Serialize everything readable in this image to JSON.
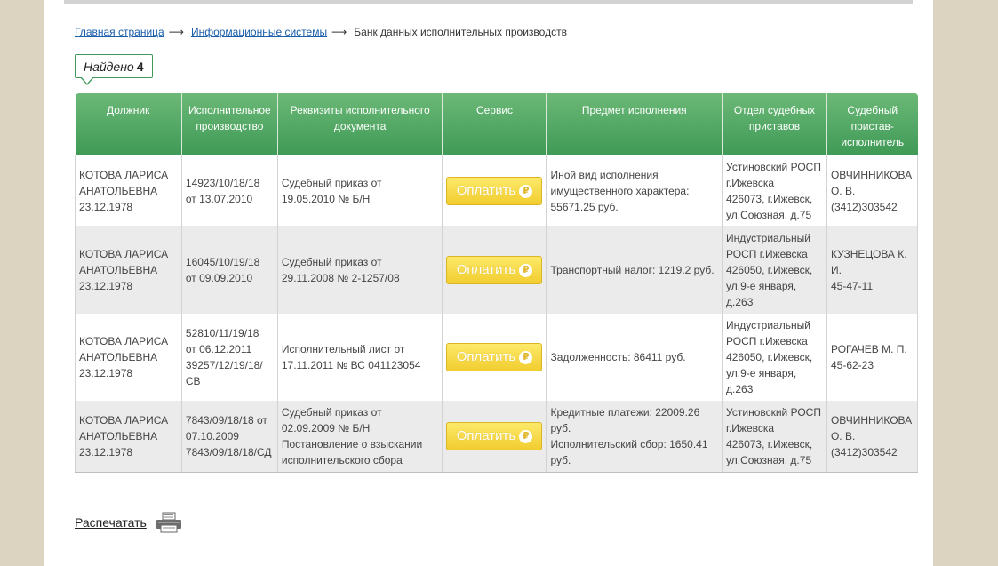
{
  "breadcrumb": {
    "home": "Главная страница",
    "systems": "Информационные системы",
    "current": "Банк данных исполнительных производств",
    "separator": "⟶"
  },
  "found": {
    "label": "Найдено",
    "count": "4"
  },
  "table": {
    "headers": [
      "Должник",
      "Исполнительное производство",
      "Реквизиты исполнительного документа",
      "Сервис",
      "Предмет исполнения",
      "Отдел судебных приставов",
      "Судебный пристав-исполнитель"
    ],
    "pay_label": "Оплатить",
    "rub_symbol": "₽",
    "rows": [
      {
        "debtor": [
          "КОТОВА ЛАРИСА",
          "АНАТОЛЬЕВНА",
          "23.12.1978"
        ],
        "proceeding": [
          "14923/10/18/18",
          "от 13.07.2010"
        ],
        "document": [
          "Судебный приказ от",
          "19.05.2010 № Б/Н"
        ],
        "subject": [
          "Иной вид исполнения",
          "имущественного характера:",
          "55671.25 руб."
        ],
        "department": [
          "Устиновский РОСП",
          "г.Ижевска",
          "426073, г.Ижевск,",
          "ул.Союзная, д.75"
        ],
        "bailiff": [
          "ОВЧИННИКОВА",
          "О. В.",
          "(3412)303542"
        ]
      },
      {
        "debtor": [
          "КОТОВА ЛАРИСА",
          "АНАТОЛЬЕВНА",
          "23.12.1978"
        ],
        "proceeding": [
          "16045/10/19/18",
          "от 09.09.2010"
        ],
        "document": [
          "Судебный приказ от",
          "29.11.2008 № 2-1257/08"
        ],
        "subject": [
          "Транспортный налог: 1219.2 руб."
        ],
        "department": [
          "Индустриальный",
          "РОСП г.Ижевска",
          "426050, г.Ижевск,",
          "ул.9-е января,",
          "д.263"
        ],
        "bailiff": [
          "КУЗНЕЦОВА К.",
          "И.",
          "45-47-11"
        ]
      },
      {
        "debtor": [
          "КОТОВА ЛАРИСА",
          "АНАТОЛЬЕВНА",
          "23.12.1978"
        ],
        "proceeding": [
          "52810/11/19/18",
          "от 06.12.2011",
          "39257/12/19/18/",
          "СВ"
        ],
        "document": [
          "Исполнительный лист от",
          "17.11.2011 № ВС 041123054"
        ],
        "subject": [
          "Задолженность: 86411 руб."
        ],
        "department": [
          "Индустриальный",
          "РОСП г.Ижевска",
          "426050, г.Ижевск,",
          "ул.9-е января,",
          "д.263"
        ],
        "bailiff": [
          "РОГАЧЕВ М. П.",
          "45-62-23"
        ]
      },
      {
        "debtor": [
          "КОТОВА ЛАРИСА",
          "АНАТОЛЬЕВНА",
          "23.12.1978"
        ],
        "proceeding": [
          "7843/09/18/18 от",
          "07.10.2009",
          "7843/09/18/18/СД"
        ],
        "document": [
          "Судебный приказ от",
          "02.09.2009 № Б/Н",
          "Постановление о взыскании",
          "исполнительского сбора"
        ],
        "subject": [
          "Кредитные платежи: 22009.26",
          "руб.",
          "Исполнительский сбор: 1650.41",
          "руб."
        ],
        "department": [
          "Устиновский РОСП",
          "г.Ижевска",
          "426073, г.Ижевск,",
          "ул.Союзная, д.75"
        ],
        "bailiff": [
          "ОВЧИННИКОВА",
          "О. В.",
          "(3412)303542"
        ]
      }
    ]
  },
  "print": {
    "label": "Распечатать",
    "icon": "printer-icon"
  },
  "colors": {
    "header_green": "#4ca762",
    "link_blue": "#1a5eab",
    "button_yellow": "#f6d83f",
    "row_alt": "#ebebeb"
  }
}
